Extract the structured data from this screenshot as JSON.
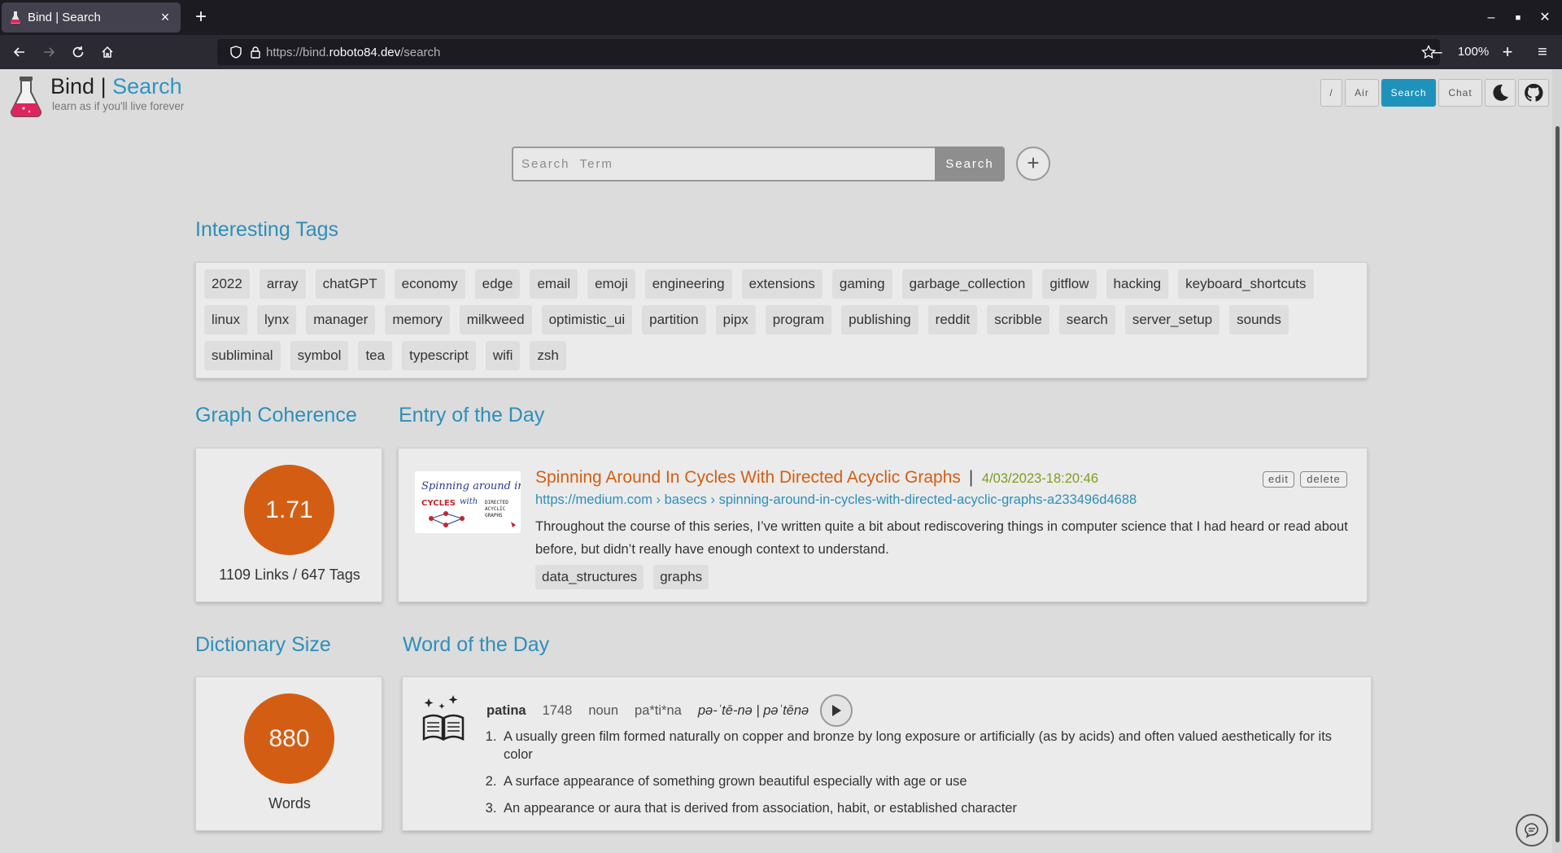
{
  "browser": {
    "tab_title": "Bind | Search",
    "url_prefix": "https://bind.",
    "url_host": "roboto84.dev",
    "url_path": "/search",
    "zoom": "100%"
  },
  "header": {
    "brand_main": "Bind",
    "brand_sep": "|",
    "brand_sub": "Search",
    "tagline": "learn as if you'll live forever",
    "nav": [
      "/",
      "Air",
      "Search",
      "Chat"
    ]
  },
  "search": {
    "placeholder": "Search  Term",
    "button": "Search",
    "add": "+"
  },
  "tags_section": {
    "title": "Interesting Tags",
    "rows": [
      [
        "2022",
        "array",
        "chatGPT",
        "economy",
        "edge",
        "email",
        "emoji",
        "engineering",
        "extensions",
        "gaming",
        "garbage_collection",
        "gitflow",
        "hacking",
        "keyboard_shortcuts"
      ],
      [
        "linux",
        "lynx",
        "manager",
        "memory",
        "milkweed",
        "optimistic_ui",
        "partition",
        "pipx",
        "program",
        "publishing",
        "reddit",
        "scribble",
        "search",
        "server_setup",
        "sounds"
      ],
      [
        "subliminal",
        "symbol",
        "tea",
        "typescript",
        "wifi",
        "zsh"
      ]
    ]
  },
  "coherence": {
    "title": "Graph Coherence",
    "value": "1.71",
    "caption": "1109 Links / 647 Tags"
  },
  "entry": {
    "section_title": "Entry of the Day",
    "title": "Spinning Around In Cycles With Directed Acyclic Graphs",
    "pipe": "|",
    "date": "4/03/2023-18:20:46",
    "url": "https://medium.com › basecs › spinning-around-in-cycles-with-directed-acyclic-graphs-a233496d4688",
    "description": "Throughout the course of this series, I’ve written quite a bit about rediscovering things in computer science that I had heard or read about before, but didn’t really have enough context to understand.",
    "tags": [
      "data_structures",
      "graphs"
    ],
    "edit": "edit",
    "delete": "delete",
    "thumb_line1": "Spinning around in",
    "thumb_line2": "CYCLES",
    "thumb_line3": "with",
    "thumb_line4": "DIRECTED",
    "thumb_line5": "ACYCLIC",
    "thumb_line6": "GRAPHS"
  },
  "dictionary": {
    "title": "Dictionary Size",
    "value": "880",
    "caption": "Words"
  },
  "word": {
    "section_title": "Word of the Day",
    "term": "patina",
    "year": "1748",
    "pos": "noun",
    "syllables": "pa*ti*na",
    "phonetic": "pə-ˈtē-nə | pəˈtēnə",
    "definitions": [
      "A usually green film formed naturally on copper and bronze by long exposure or artificially (as by acids) and often valued aesthetically for its color",
      "A surface appearance of something grown beautiful especially with age or use",
      "An appearance or aura that is derived from association, habit, or established character"
    ]
  },
  "colors": {
    "accent": "#2d8fb9",
    "orange": "#d35e13",
    "date_green": "#7f9c1d",
    "active_nav": "#1e92bb"
  }
}
